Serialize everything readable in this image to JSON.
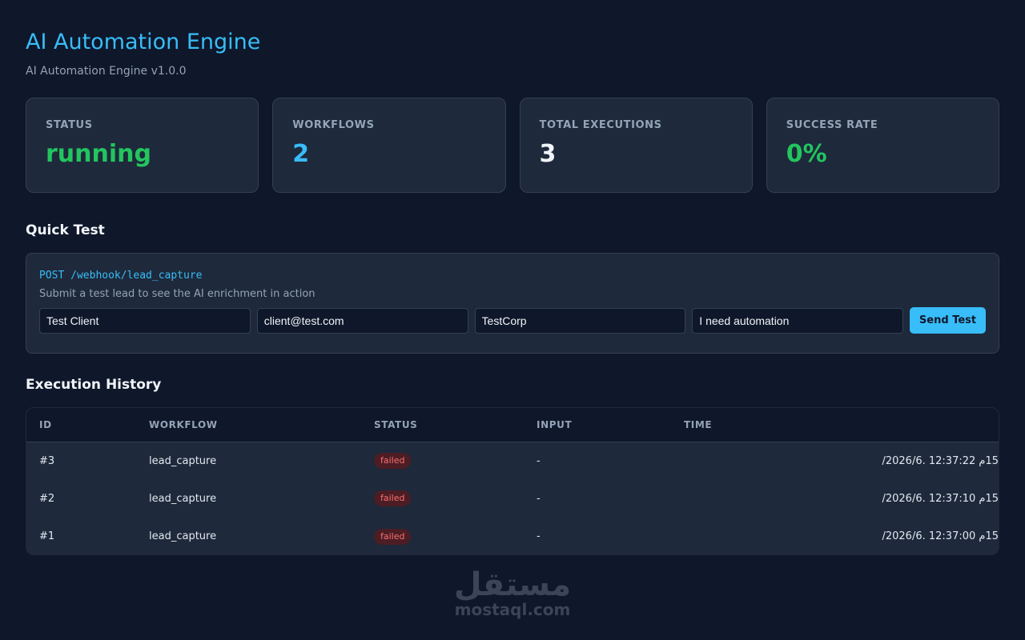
{
  "header": {
    "title": "AI Automation Engine",
    "subtitle": "AI Automation Engine v1.0.0"
  },
  "stats": [
    {
      "label": "STATUS",
      "value": "running",
      "color": "#22c55e"
    },
    {
      "label": "WORKFLOWS",
      "value": "2",
      "color": "#38bdf8"
    },
    {
      "label": "TOTAL EXECUTIONS",
      "value": "3",
      "color": "#f1f5f9"
    },
    {
      "label": "SUCCESS RATE",
      "value": "0%",
      "color": "#22c55e"
    }
  ],
  "quick_test": {
    "title": "Quick Test",
    "endpoint": "POST /webhook/lead_capture",
    "description": "Submit a test lead to see the AI enrichment in action",
    "inputs": [
      {
        "value": "Test Client"
      },
      {
        "value": "client@test.com"
      },
      {
        "value": "TestCorp"
      },
      {
        "value": "I need automation"
      }
    ],
    "send_label": "Send Test"
  },
  "history": {
    "title": "Execution History",
    "columns": [
      "ID",
      "WORKFLOW",
      "STATUS",
      "INPUT",
      "TIME"
    ],
    "rows": [
      {
        "id": "#3",
        "workflow": "lead_capture",
        "status": "failed",
        "input": "-",
        "time": "15م 12:37:22 .2026/6/"
      },
      {
        "id": "#2",
        "workflow": "lead_capture",
        "status": "failed",
        "input": "-",
        "time": "15م 12:37:10 .2026/6/"
      },
      {
        "id": "#1",
        "workflow": "lead_capture",
        "status": "failed",
        "input": "-",
        "time": "15م 12:37:00 .2026/6/"
      }
    ]
  },
  "watermark": {
    "arabic": "مستقل",
    "latin": "mostaql.com"
  }
}
